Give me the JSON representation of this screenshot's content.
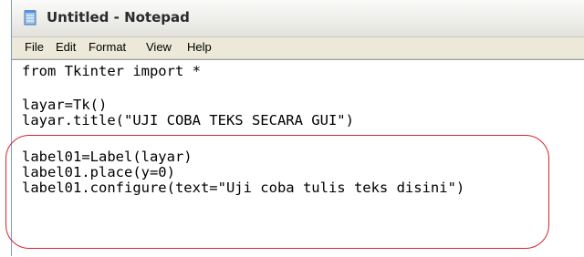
{
  "window": {
    "title": "Untitled - Notepad",
    "app_icon": "notepad-icon"
  },
  "menu": {
    "file": "File",
    "edit": "Edit",
    "format": "Format",
    "view": "View",
    "help": "Help"
  },
  "editor": {
    "lines": [
      "from Tkinter import *",
      "",
      "layar=Tk()",
      "layar.title(\"UJI COBA TEKS SECARA GUI\")",
      "",
      "label01=Label(layar)",
      "label01.place(y=0)",
      "label01.configure(text=\"Uji coba tulis teks disini\")"
    ]
  },
  "annotation": {
    "color": "#d8242b"
  }
}
